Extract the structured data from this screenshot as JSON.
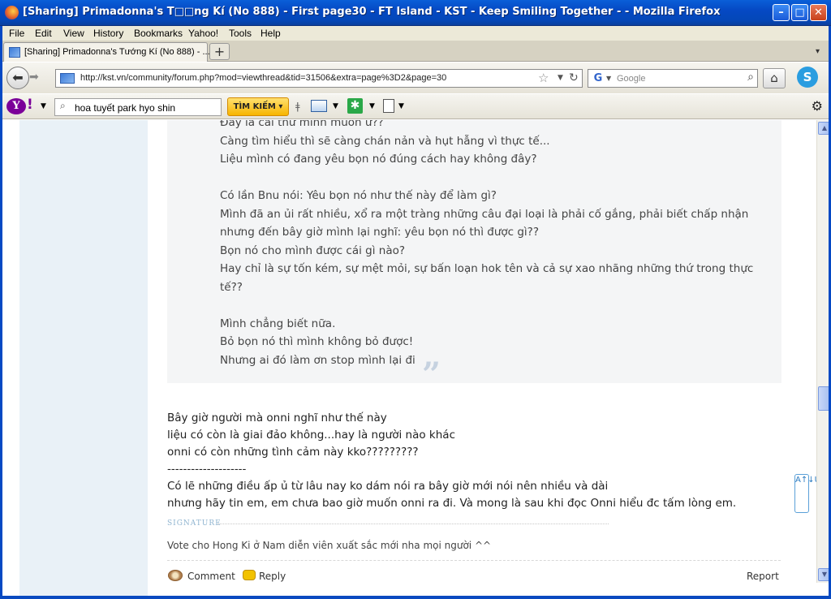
{
  "window": {
    "title": "[Sharing] Primadonna's T□□ng Kí (No 888) - First page30 - FT Island - KST - Keep Smiling Together - - Mozilla Firefox",
    "min": "–",
    "max": "□",
    "close": "✕"
  },
  "menu": [
    "File",
    "Edit",
    "View",
    "History",
    "Bookmarks",
    "Yahoo!",
    "Tools",
    "Help"
  ],
  "tab": {
    "label": "[Sharing] Primadonna's Tướng Kí (No 888) - ...",
    "new": "+"
  },
  "nav": {
    "url": "http://kst.vn/community/forum.php?mod=viewthread&tid=31506&extra=page%3D2&page=30",
    "search_placeholder": "Google"
  },
  "yahoo": {
    "logo": "Y",
    "excl": "!",
    "search_value": "hoa tuyết park hyo shin",
    "search_button": "TÌM KIẾM ▾"
  },
  "quote": {
    "lines": [
      "Đây là cái thứ mình muốn ư??",
      "Càng tìm hiểu thì sẽ càng chán nản và hụt hẫng vì thực tế...",
      "Liệu mình có đang yêu bọn nó đúng cách hay không đây?",
      "",
      "Có lần Bnu nói: Yêu bọn nó như thế này để làm gì?",
      "Mình đã an ủi rất nhiều, xổ ra một tràng những câu đại loại là phải cố gắng, phải biết chấp nhận",
      "nhưng đến bây giờ mình lại nghĩ: yêu bọn nó thì được gì??",
      "Bọn nó cho mình được cái gì nào?",
      "Hay chỉ là sự tốn kém, sự mệt mỏi, sự bấn loạn hok tên và cả sự xao nhãng những thứ trong thực",
      "tế??",
      "",
      "Mình chẳng biết nữa.",
      "Bỏ bọn nó thì mình không bỏ được!",
      "Nhưng ai đó làm ơn stop mình lại đi"
    ],
    "mark": "”"
  },
  "post": {
    "lines": [
      "Bây giờ người mà onni nghĩ như thế này",
      "liệu có còn là giai đảo không...hay là người nào khác",
      "onni có còn những tình cảm này kko?????????",
      "--------------------",
      "Có lẽ những điều ấp ủ từ lâu nay ko dám nói ra bây giờ mới nói nên nhiều và dài",
      "nhưng hãy tin em, em chưa bao giờ muốn onni ra đi. Và mong là sau khi đọc Onni hiểu đc tấm lòng em."
    ],
    "signature_label": "SIGNATURE",
    "signature_text": "Vote cho Hong Ki ở Nam diễn viên xuất sắc mới nha mọi người ^^",
    "comment": "Comment",
    "reply": "Reply",
    "report": "Report"
  },
  "side_widget": "A↑↓U"
}
